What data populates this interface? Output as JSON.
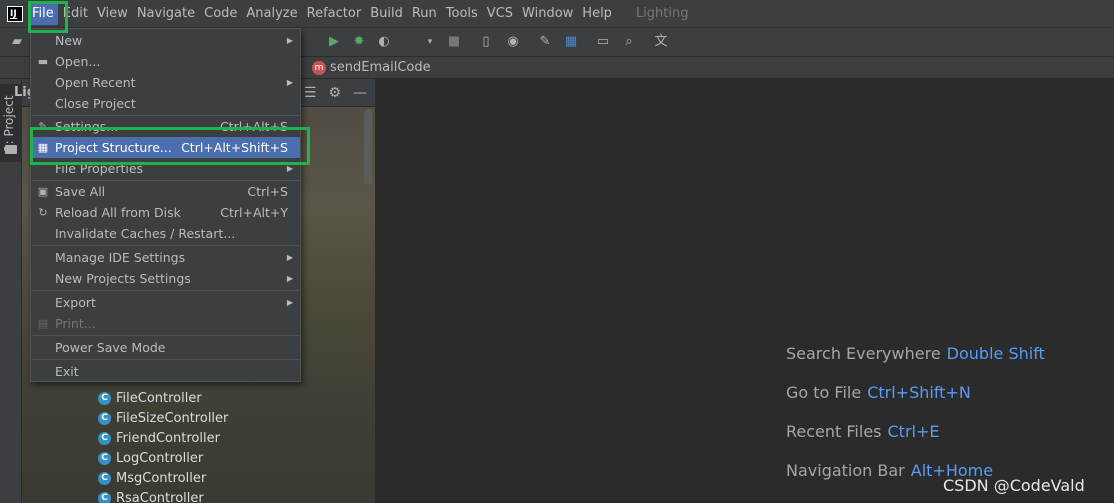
{
  "menubar": {
    "items": [
      {
        "label": "File",
        "active": true
      },
      {
        "label": "Edit"
      },
      {
        "label": "View"
      },
      {
        "label": "Navigate"
      },
      {
        "label": "Code"
      },
      {
        "label": "Analyze"
      },
      {
        "label": "Refactor"
      },
      {
        "label": "Build"
      },
      {
        "label": "Run"
      },
      {
        "label": "Tools"
      },
      {
        "label": "VCS"
      },
      {
        "label": "Window"
      },
      {
        "label": "Help"
      }
    ],
    "project_title": "Lighting"
  },
  "navbar": {
    "method_badge": "m",
    "method_name": "sendEmailCode"
  },
  "panel": {
    "header_label": "Lig"
  },
  "left_stripe": {
    "project_tab": "1: Project"
  },
  "file_menu": {
    "items": {
      "new": {
        "label": "New",
        "submenu": true
      },
      "open": {
        "label": "Open...",
        "icon": "folder-open-icon"
      },
      "open_recent": {
        "label": "Open Recent",
        "submenu": true
      },
      "close_project": {
        "label": "Close Project"
      },
      "settings": {
        "label": "Settings...",
        "shortcut": "Ctrl+Alt+S",
        "icon": "wrench-icon"
      },
      "project_structure": {
        "label": "Project Structure...",
        "shortcut": "Ctrl+Alt+Shift+S",
        "selected": true,
        "icon": "project-structure-icon"
      },
      "file_properties": {
        "label": "File Properties",
        "submenu": true
      },
      "save_all": {
        "label": "Save All",
        "shortcut": "Ctrl+S",
        "icon": "save-icon"
      },
      "reload": {
        "label": "Reload All from Disk",
        "shortcut": "Ctrl+Alt+Y",
        "icon": "reload-icon"
      },
      "invalidate": {
        "label": "Invalidate Caches / Restart..."
      },
      "manage_ide": {
        "label": "Manage IDE Settings",
        "submenu": true
      },
      "new_projects": {
        "label": "New Projects Settings",
        "submenu": true
      },
      "export": {
        "label": "Export",
        "submenu": true
      },
      "print": {
        "label": "Print...",
        "disabled": true,
        "icon": "print-icon"
      },
      "power_save": {
        "label": "Power Save Mode"
      },
      "exit": {
        "label": "Exit"
      }
    }
  },
  "project_tree": {
    "class_badge": "C",
    "items": [
      "FileController",
      "FileSizeController",
      "FriendController",
      "LogController",
      "MsgController",
      "RsaController"
    ]
  },
  "editor_hints": [
    {
      "label": "Search Everywhere",
      "key": "Double Shift"
    },
    {
      "label": "Go to File",
      "key": "Ctrl+Shift+N"
    },
    {
      "label": "Recent Files",
      "key": "Ctrl+E"
    },
    {
      "label": "Navigation Bar",
      "key": "Alt+Home"
    }
  ],
  "watermark": "CSDN @CodeVald",
  "colors": {
    "highlight_green": "#22b14c",
    "selection_blue": "#4b6eaf",
    "shortcut_blue": "#589df6"
  }
}
